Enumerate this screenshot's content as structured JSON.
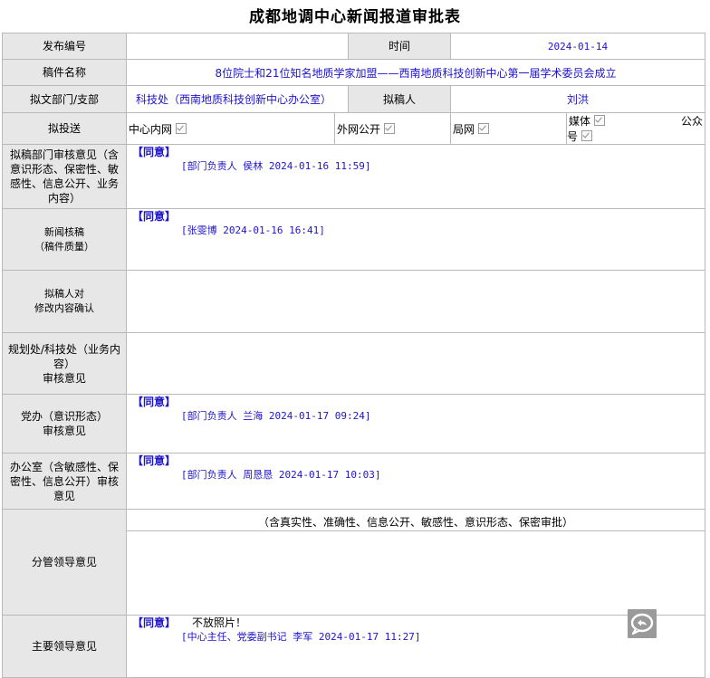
{
  "title": "成都地调中心新闻报道审批表",
  "labels": {
    "release_no": "发布编号",
    "time": "时间",
    "manuscript_name": "稿件名称",
    "dept": "拟文部门/支部",
    "drafter": "拟稿人",
    "send_to": "拟投送",
    "dept_review": "拟稿部门审核意见（含意识形态、保密性、敏感性、信息公开、业务内容）",
    "news_review_1": "新闻核稿",
    "news_review_2": "（稿件质量）",
    "drafter_confirm_1": "拟稿人对",
    "drafter_confirm_2": "修改内容确认",
    "planning_review_1": "规划处/科技处（业务内容）",
    "planning_review_2": "审核意见",
    "party_review_1": "党办（意识形态）",
    "party_review_2": "审核意见",
    "office_review": "办公室（含敏感性、保密性、信息公开）审核意见",
    "leader_in_charge": "分管领导意见",
    "main_leader": "主要领导意见"
  },
  "values": {
    "release_no": "",
    "time": "2024-01-14",
    "manuscript_name": "8位院士和21位知名地质学家加盟——西南地质科技创新中心第一届学术委员会成立",
    "dept": "科技处（西南地质科技创新中心办公室）",
    "drafter": "刘洪"
  },
  "channels": [
    {
      "label": "中心内网",
      "checked": true
    },
    {
      "label": "外网公开",
      "checked": true
    },
    {
      "label": "局网",
      "checked": true
    },
    {
      "label": "媒体",
      "checked": true
    },
    {
      "label": "公众号",
      "checked": true
    }
  ],
  "opinions": {
    "agree": "【同意】",
    "dept_sig": "[部门负责人  侯林  2024-01-16 11:59]",
    "news_sig": "[张雯博  2024-01-16 16:41]",
    "party_sig": "[部门负责人  兰海  2024-01-17 09:24]",
    "office_sig": "[部门负责人  周恳恳  2024-01-17 10:03]",
    "leader_note": "（含真实性、准确性、信息公开、敏感性、意识形态、保密审批）",
    "main_comment": "不放照片！",
    "main_sig": "[中心主任、党委副书记  李军  2024-01-17 11:27]"
  },
  "icons": {
    "chat": "chat-bubble-icon"
  }
}
